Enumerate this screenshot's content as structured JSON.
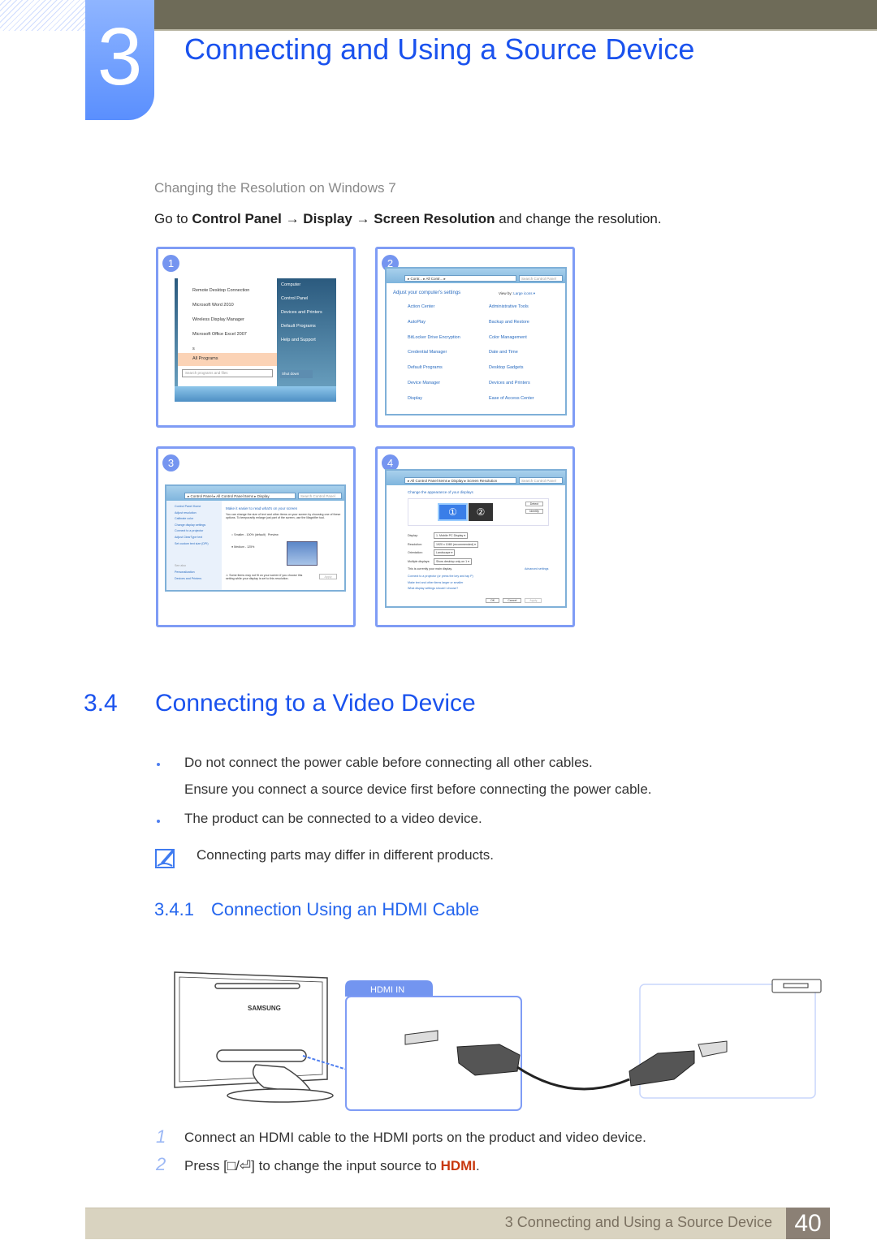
{
  "chapter": {
    "number": "3",
    "title": "Connecting and Using a Source Device"
  },
  "resolution_section": {
    "subheading": "Changing the Resolution on Windows 7",
    "instruction": {
      "prefix": "Go to ",
      "step1": "Control Panel",
      "arrow": "→",
      "step2": "Display",
      "step3": "Screen Resolution",
      "suffix": " and change the resolution."
    },
    "panels": [
      {
        "number": "1",
        "start_menu": {
          "programs": [
            "Remote Desktop Connection",
            "Microsoft Word 2010",
            "Wireless Display Manager",
            "Microsoft Office Excel 2007",
            "s"
          ],
          "all_programs": "All Programs",
          "search_placeholder": "Search programs and files",
          "right_items": [
            "Computer",
            "Control Panel",
            "Devices and Printers",
            "Default Programs",
            "Help and Support"
          ],
          "shutdown": "Shut down"
        }
      },
      {
        "number": "2",
        "address": "▸ Contr... ▸ All Contr... ▸",
        "search": "Search Control Panel",
        "heading": "Adjust your computer's settings",
        "view_by": "View by:",
        "view_value": "Large icons ▾",
        "items": [
          "Action Center",
          "Administrative Tools",
          "AutoPlay",
          "Backup and Restore",
          "BitLocker Drive Encryption",
          "Color Management",
          "Credential Manager",
          "Date and Time",
          "Default Programs",
          "Desktop Gadgets",
          "Device Manager",
          "Devices and Printers",
          "Display",
          "Ease of Access Center"
        ]
      },
      {
        "number": "3",
        "address": "▸ Control Panel ▸ All Control Panel Items ▸ Display",
        "search": "Search Control Panel",
        "side_links": [
          "Control Panel Home",
          "Adjust resolution",
          "Calibrate color",
          "Change display settings",
          "Connect to a projector",
          "Adjust ClearType text",
          "Set custom text size (DPI)"
        ],
        "see_also": "See also",
        "see_also_links": [
          "Personalization",
          "Devices and Printers"
        ],
        "heading": "Make it easier to read what's on your screen",
        "description": "You can change the size of text and other items on your screen by choosing one of these options. To temporarily enlarge just part of the screen, use the Magnifier tool.",
        "option_small": "Smaller - 100% (default)",
        "preview": "Preview",
        "option_medium": "Medium - 125%",
        "warning": "Some items may not fit on your screen if you choose this setting while your display is set to this resolution.",
        "apply": "Apply"
      },
      {
        "number": "4",
        "address": "▸ All Control Panel Items ▸ Display ▸ Screen Resolution",
        "search": "Search Control Panel",
        "heading": "Change the appearance of your displays",
        "detect": "Detect",
        "identify": "Identify",
        "fields": [
          {
            "label": "Display:",
            "value": "1. Mobile PC Display ▾"
          },
          {
            "label": "Resolution:",
            "value": "1920 x 1080 (recommended) ▾"
          },
          {
            "label": "Orientation:",
            "value": "Landscape ▾"
          },
          {
            "label": "Multiple displays:",
            "value": "Show desktop only on 1 ▾"
          }
        ],
        "current_display": "This is currently your main display.",
        "advanced": "Advanced settings",
        "links": [
          "Connect to a projector (or press the key and tap P)",
          "Make text and other items larger or smaller",
          "What display settings should I choose?"
        ],
        "ok": "OK",
        "cancel": "Cancel",
        "apply": "Apply"
      }
    ]
  },
  "section_34": {
    "number": "3.4",
    "title": "Connecting to a Video Device",
    "bullets": [
      {
        "text": "Do not connect the power cable before connecting all other cables.",
        "continuation": "Ensure you connect a source device first before connecting the power cable."
      },
      {
        "text": "The product can be connected to a video device."
      }
    ],
    "note": "Connecting parts may differ in different products."
  },
  "section_341": {
    "number": "3.4.1",
    "title": "Connection Using an HDMI Cable",
    "diagram": {
      "port_label": "HDMI IN",
      "brand": "SAMSUNG"
    },
    "steps": [
      {
        "number": "1",
        "text": "Connect an HDMI cable to the HDMI ports on the product and video device."
      },
      {
        "number": "2",
        "prefix": "Press [",
        "button_glyph": "□/⏎",
        "middle": "] to change the input source to ",
        "highlight": "HDMI",
        "suffix": "."
      }
    ]
  },
  "footer": {
    "chapter_label": "3 Connecting and Using a Source Device",
    "page": "40"
  },
  "colors": {
    "heading_blue": "#1a52ee",
    "panel_border": "#7f9cf5",
    "highlight_red": "#c8380e",
    "footer_bg": "#d9d3c0",
    "topbar": "#6e6b58"
  }
}
